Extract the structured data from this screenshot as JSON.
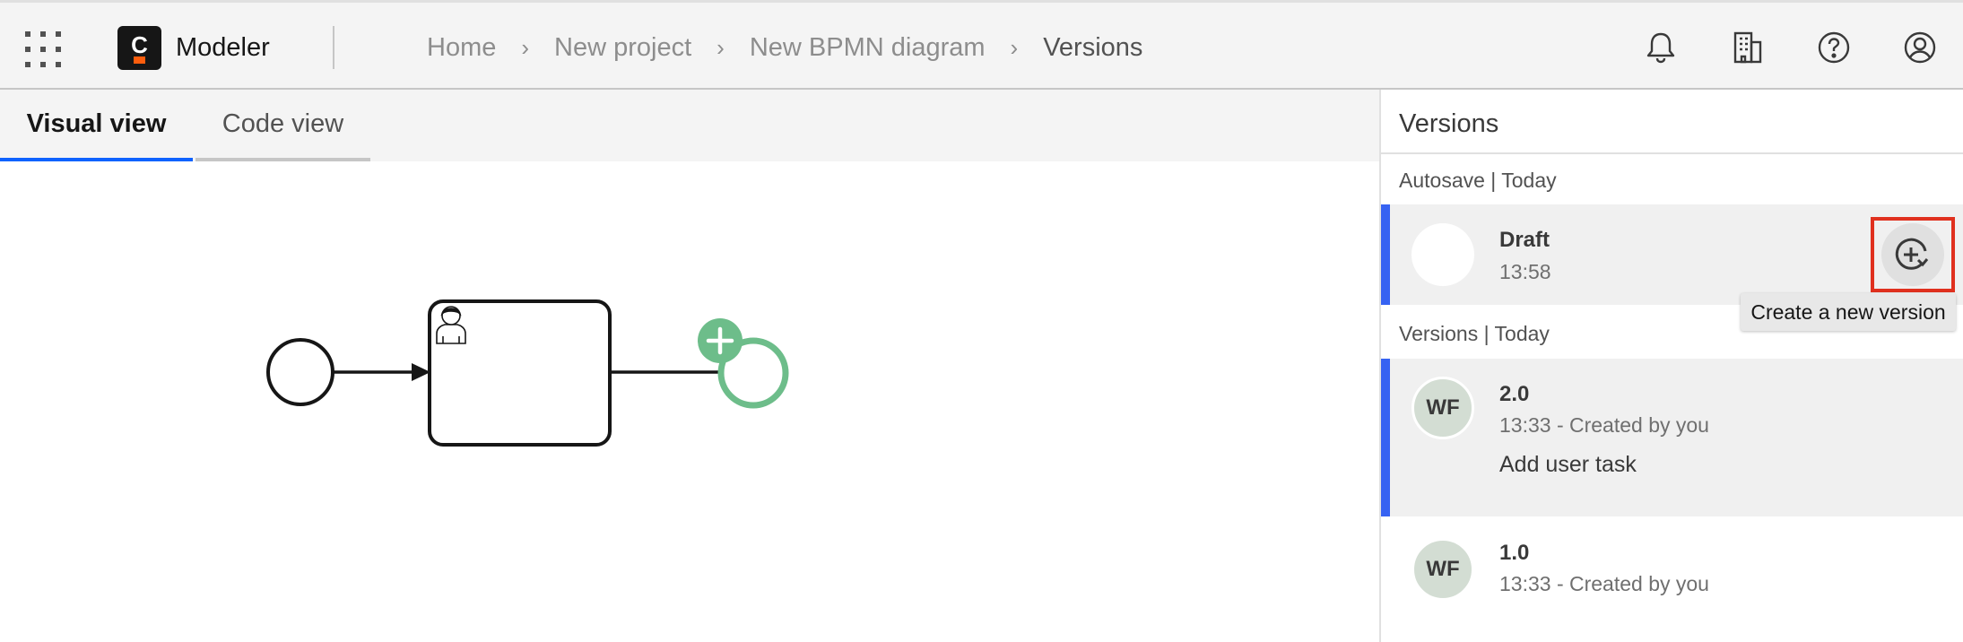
{
  "header": {
    "app_name": "Modeler",
    "logo_letter": "C",
    "breadcrumb": [
      "Home",
      "New project",
      "New BPMN diagram",
      "Versions"
    ],
    "separator": "›",
    "icons": [
      "notification-icon",
      "organization-icon",
      "help-icon",
      "user-icon"
    ]
  },
  "tabs": [
    {
      "label": "Visual view",
      "active": true
    },
    {
      "label": "Code view",
      "active": false
    }
  ],
  "diagram": {
    "elements": [
      "start-event",
      "user-task",
      "end-event"
    ],
    "task_type": "user-task",
    "end_event_state": "appending"
  },
  "versions_panel": {
    "title": "Versions",
    "autosave_label": "Autosave | Today",
    "draft": {
      "name": "Draft",
      "time": "13:58"
    },
    "create_button_tooltip": "Create a new version",
    "versions_label": "Versions | Today",
    "items": [
      {
        "avatar": "WF",
        "name": "2.0",
        "meta": "13:33 - Created by you",
        "description": "Add user task",
        "selected": true
      },
      {
        "avatar": "WF",
        "name": "1.0",
        "meta": "13:33 - Created by you",
        "description": "",
        "selected": false
      }
    ]
  },
  "colors": {
    "accent": "#0f62fe",
    "selection_bar": "#3662f2",
    "highlight_box": "#e0301e",
    "new_element_green": "#6dbd8a",
    "logo_orange": "#fc5d0d"
  }
}
